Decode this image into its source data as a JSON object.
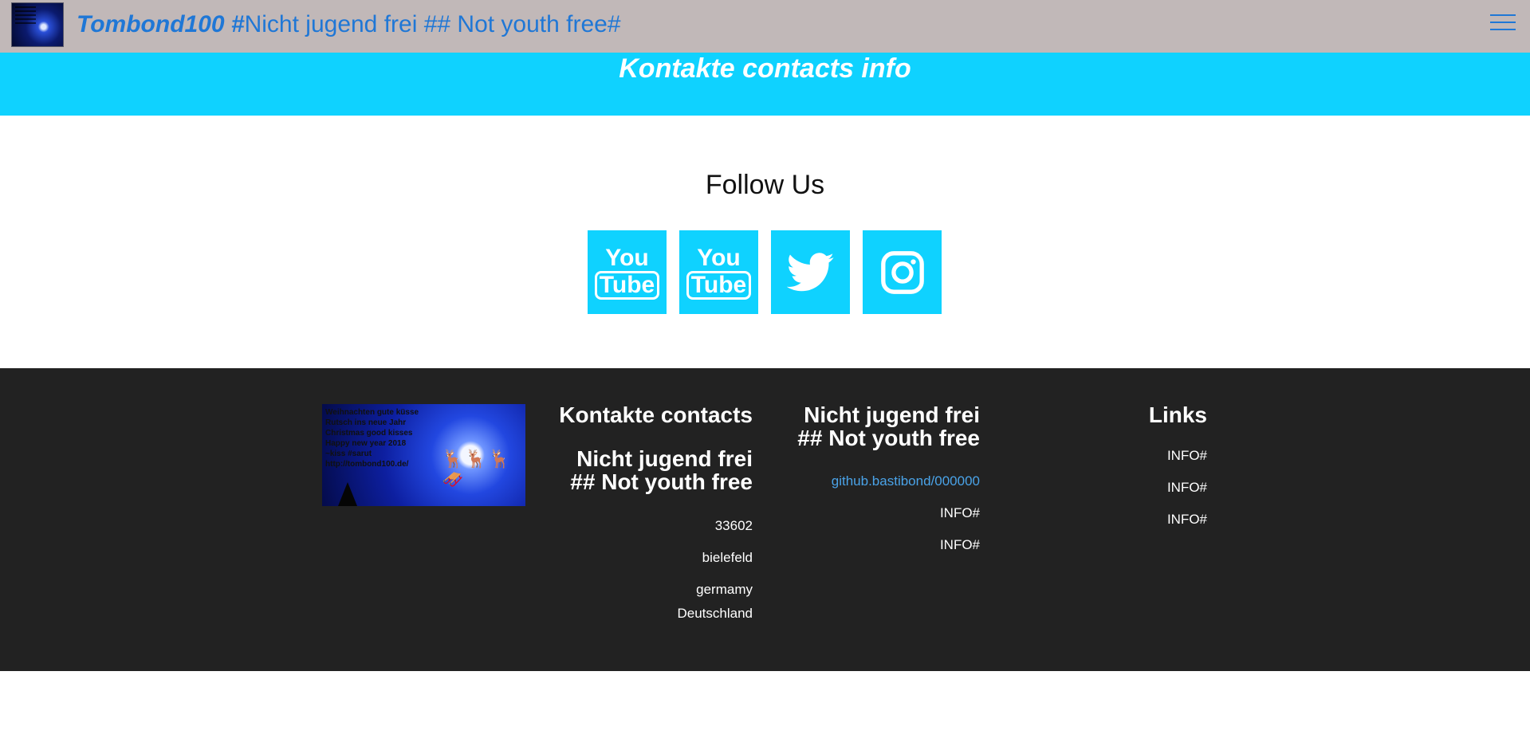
{
  "navbar": {
    "brand": "Tombond100 #",
    "title_rest": "Nicht jugend frei ## Not youth free#"
  },
  "banner": {
    "title": "Kontakte contacts info"
  },
  "follow": {
    "title": "Follow Us",
    "youtube_1": {
      "you": "You",
      "tube": "Tube"
    },
    "youtube_2": {
      "you": "You",
      "tube": "Tube"
    }
  },
  "footer": {
    "image_text": [
      "Weihnachten gute küsse",
      "Rutsch ins neue Jahr",
      "Christmas good kisses",
      "Happy new year 2018",
      "~kiss #sarut",
      "http://tombond100.de/"
    ],
    "col1": {
      "heading": "Kontakte contacts",
      "subheading_line1": "Nicht jugend frei",
      "subheading_line2": "## Not youth free",
      "zip": "33602",
      "city": "bielefeld",
      "country_line1": "germamy",
      "country_line2": "Deutschland"
    },
    "col2": {
      "heading_line1": "Nicht jugend frei",
      "heading_line2": "## Not youth free",
      "link": "github.bastibond/000000",
      "info1": "INFO#",
      "info2": "INFO#"
    },
    "col3": {
      "heading": "Links",
      "info1": "INFO#",
      "info2": "INFO#",
      "info3": "INFO#"
    }
  },
  "colors": {
    "navbar_bg": "#c1b8b8",
    "brand_blue": "#1f77d6",
    "accent_cyan": "#0fd2ff",
    "footer_bg": "#222222",
    "link_blue": "#4aa3e8"
  }
}
